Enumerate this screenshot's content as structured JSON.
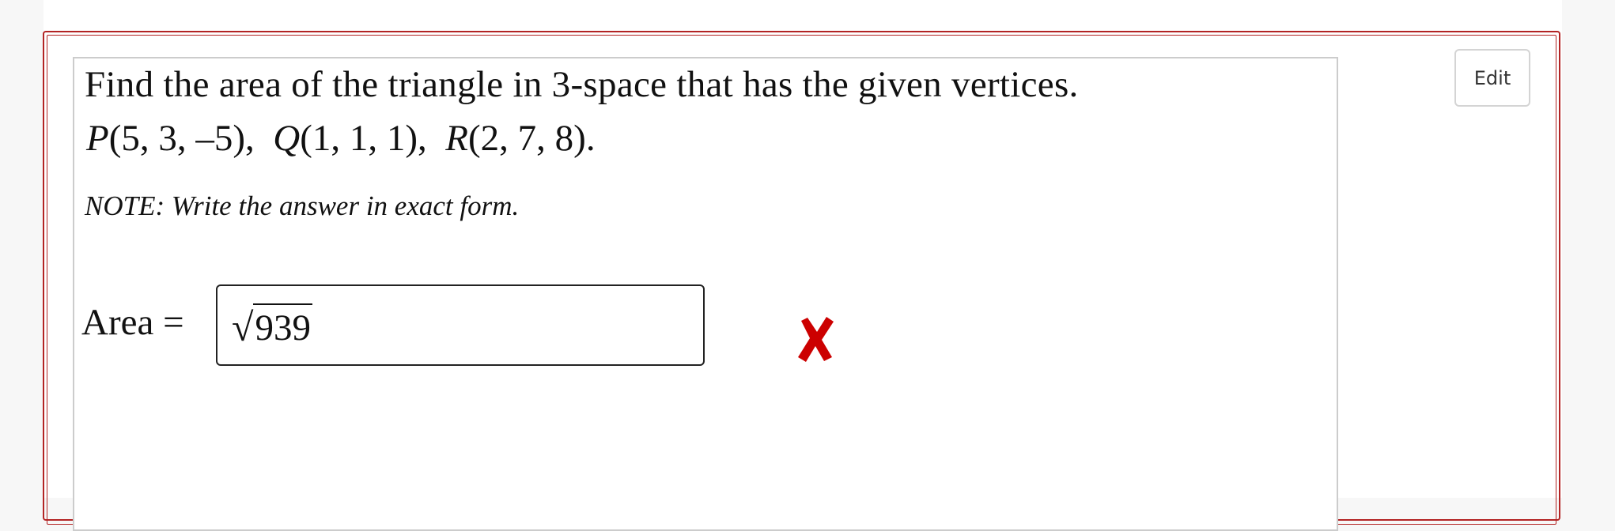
{
  "question": {
    "prompt": "Find the area of the triangle in 3-space that has the given vertices.",
    "vertices": [
      {
        "name": "P",
        "coords": "(5, 3, –5)"
      },
      {
        "name": "Q",
        "coords": "(1, 1, 1)"
      },
      {
        "name": "R",
        "coords": "(2, 7, 8)"
      }
    ],
    "vertices_suffix": ".",
    "note": "NOTE: Write the answer in exact form."
  },
  "answer": {
    "label": "Area =",
    "radicand": "939",
    "status": "incorrect",
    "status_color": "#cc0000"
  },
  "toolbar": {
    "edit_label": "Edit"
  },
  "colors": {
    "frame_border": "#b32424",
    "panel_border": "#cccccc"
  }
}
